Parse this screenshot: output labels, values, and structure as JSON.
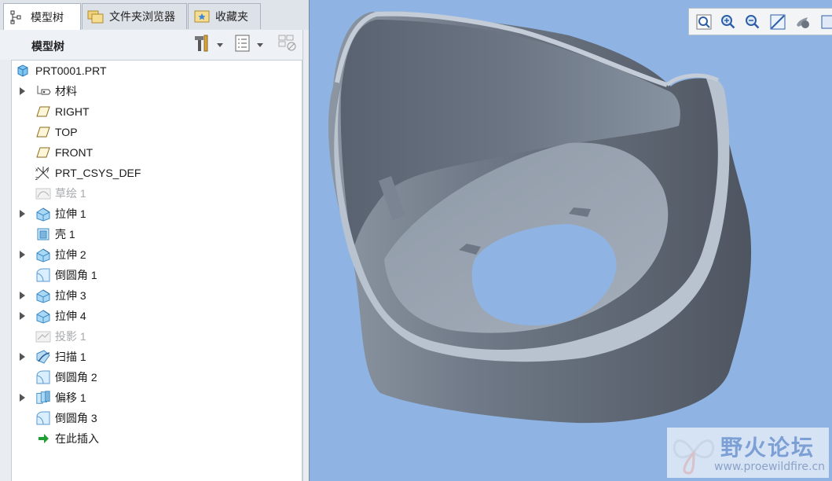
{
  "tabs": [
    {
      "label": "模型树",
      "icon": "model-tree-icon",
      "active": true
    },
    {
      "label": "文件夹浏览器",
      "icon": "folder-browser-icon",
      "active": false
    },
    {
      "label": "收藏夹",
      "icon": "favorites-icon",
      "active": false
    }
  ],
  "panel": {
    "title": "模型树",
    "tools": [
      "settings-tools-icon",
      "show-list-icon",
      "filter-columns-icon"
    ]
  },
  "tree": {
    "root": "PRT0001.PRT",
    "items": [
      {
        "label": "材料",
        "icon": "material-icon",
        "expandable": true,
        "dim": false
      },
      {
        "label": "RIGHT",
        "icon": "datum-plane-icon",
        "expandable": false,
        "dim": false
      },
      {
        "label": "TOP",
        "icon": "datum-plane-icon",
        "expandable": false,
        "dim": false
      },
      {
        "label": "FRONT",
        "icon": "datum-plane-icon",
        "expandable": false,
        "dim": false
      },
      {
        "label": "PRT_CSYS_DEF",
        "icon": "coordinate-system-icon",
        "expandable": false,
        "dim": false
      },
      {
        "label": "草绘 1",
        "icon": "sketch-icon",
        "expandable": false,
        "dim": true
      },
      {
        "label": "拉伸 1",
        "icon": "extrude-icon",
        "expandable": true,
        "dim": false
      },
      {
        "label": "壳 1",
        "icon": "shell-icon",
        "expandable": false,
        "dim": false
      },
      {
        "label": "拉伸 2",
        "icon": "extrude-icon",
        "expandable": true,
        "dim": false
      },
      {
        "label": "倒圆角 1",
        "icon": "round-icon",
        "expandable": false,
        "dim": false
      },
      {
        "label": "拉伸 3",
        "icon": "extrude-icon",
        "expandable": true,
        "dim": false
      },
      {
        "label": "拉伸 4",
        "icon": "extrude-icon",
        "expandable": true,
        "dim": false
      },
      {
        "label": "投影 1",
        "icon": "project-icon",
        "expandable": false,
        "dim": true
      },
      {
        "label": "扫描 1",
        "icon": "sweep-icon",
        "expandable": true,
        "dim": false
      },
      {
        "label": "倒圆角 2",
        "icon": "round-icon",
        "expandable": false,
        "dim": false
      },
      {
        "label": "偏移 1",
        "icon": "offset-icon",
        "expandable": true,
        "dim": false
      },
      {
        "label": "倒圆角 3",
        "icon": "round-icon",
        "expandable": false,
        "dim": false
      },
      {
        "label": "在此插入",
        "icon": "insert-here-arrow-icon",
        "expandable": false,
        "dim": false
      }
    ]
  },
  "view_toolbar": [
    "refit-icon",
    "zoom-in-icon",
    "zoom-out-icon",
    "repaint-icon",
    "spin-center-icon",
    "saved-views-icon"
  ],
  "watermark": {
    "title": "野火论坛",
    "url": "www.proewildfire.cn"
  },
  "colors": {
    "viewport_bg": "#8fb4e3",
    "model": "#7d8896",
    "accent": "#3e86d6"
  }
}
